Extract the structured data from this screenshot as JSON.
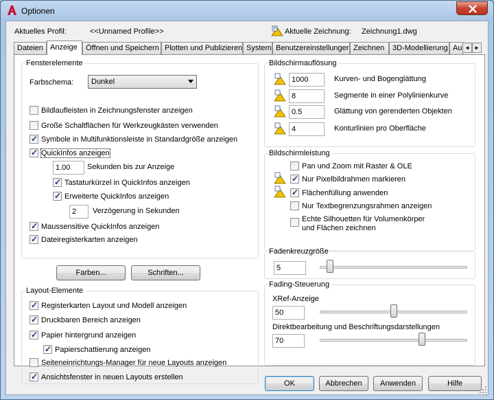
{
  "window": {
    "title": "Optionen",
    "close_label": "✕"
  },
  "header": {
    "profile_label": "Aktuelles Profil:",
    "profile_value": "<<Unnamed Profile>>",
    "drawing_label": "Aktuelle Zeichnung:",
    "drawing_value": "Zeichnung1.dwg"
  },
  "tabs": [
    {
      "label": "Dateien"
    },
    {
      "label": "Anzeige",
      "active": true
    },
    {
      "label": "Öffnen und Speichern"
    },
    {
      "label": "Plotten und Publizieren"
    },
    {
      "label": "System"
    },
    {
      "label": "Benutzereinstellungen"
    },
    {
      "label": "Zeichnen"
    },
    {
      "label": "3D-Modellierung"
    },
    {
      "label": "Au"
    }
  ],
  "tab_scroll": {
    "left": "◄",
    "right": "►"
  },
  "fensterelemente": {
    "legend": "Fensterelemente",
    "farbschema_label": "Farbschema:",
    "farbschema_value": "Dunkel",
    "cb_bildlaufleisten": {
      "label": "Bildlaufleisten in Zeichnungsfenster anzeigen",
      "checked": false
    },
    "cb_schaltflaechen": {
      "label": "Große Schaltflächen für Werkzeugkästen verwenden",
      "checked": false
    },
    "cb_symbole": {
      "label": "Symbole in Multifunktionsleiste in Standardgröße anzeigen",
      "checked": true
    },
    "cb_quickinfos": {
      "label": "QuickInfos anzeigen",
      "checked": true
    },
    "sekunden_value": "1.00",
    "sekunden_label": "Sekunden bis zur Anzeige",
    "cb_tastatur": {
      "label": "Tastaturkürzel in QuickInfos anzeigen",
      "checked": true
    },
    "cb_erweiterte": {
      "label": "Erweiterte QuickInfos anzeigen",
      "checked": true
    },
    "verzoegerung_value": "2",
    "verzoegerung_label": "Verzögerung in Sekunden",
    "cb_maussensitiv": {
      "label": "Maussensitive QuickInfos anzeigen",
      "checked": true
    },
    "cb_dateiregister": {
      "label": "Dateiregisterkarten anzeigen",
      "checked": true
    },
    "farben_button": "Farben...",
    "schriften_button": "Schriften..."
  },
  "layout": {
    "legend": "Layout-Elemente",
    "cb_registerkarten": {
      "label": "Registerkarten Layout und Modell anzeigen",
      "checked": true
    },
    "cb_druckbar": {
      "label": "Druckbaren Bereich anzeigen",
      "checked": true
    },
    "cb_papier": {
      "label": "Papier hintergrund anzeigen",
      "checked": true
    },
    "cb_schattierung": {
      "label": "Papierschattierung anzeigen",
      "checked": true
    },
    "cb_seitenmanager": {
      "label": "Seiteneinrichtungs-Manager für neue Layouts anzeigen",
      "checked": false
    },
    "cb_ansichtsfenster": {
      "label": "Ansichtsfenster in neuen Layouts erstellen",
      "checked": true
    }
  },
  "aufloesung": {
    "legend": "Bildschirmauflösung",
    "rows": [
      {
        "value": "1000",
        "label": "Kurven- und Bogenglättung"
      },
      {
        "value": "8",
        "label": "Segmente in einer Polylinienkurve"
      },
      {
        "value": "0.5",
        "label": "Glättung von gerenderten Objekten"
      },
      {
        "value": "4",
        "label": "Konturlinien pro Oberfläche"
      }
    ]
  },
  "leistung": {
    "legend": "Bildschirmleistung",
    "cb_panzoom": {
      "label": "Pan und Zoom mit Raster & OLE",
      "checked": false
    },
    "cb_pixelbild": {
      "label": "Nur Pixelbildrahmen markieren",
      "checked": true
    },
    "cb_flaechen": {
      "label": "Flächenfüllung anwenden",
      "checked": true
    },
    "cb_textbegrenzung": {
      "label": "Nur Textbegrenzungsrahmen anzeigen",
      "checked": false
    },
    "cb_silhouetten_line1": "Echte Silhouetten für Volumenkörper",
    "cb_silhouetten_line2": "und Flächen zeichnen",
    "cb_silhouetten_checked": false
  },
  "fadenkreuz": {
    "legend": "Fadenkreuzgröße",
    "value": "5",
    "slider_fraction": 0.05
  },
  "fading": {
    "legend": "Fading-Steuerung",
    "xref_label": "XRef-Anzeige",
    "xref_value": "50",
    "xref_fraction": 0.5,
    "direkt_label": "Direktbearbeitung und Beschriftungsdarstellungen",
    "direkt_value": "70",
    "direkt_fraction": 0.7
  },
  "buttons": {
    "ok": "OK",
    "abbrechen": "Abbrechen",
    "anwenden": "Anwenden",
    "hilfe": "Hilfe"
  },
  "colors": {
    "autocad_red": "#c8102e",
    "drawing_icon_yellow": "#f2c200",
    "checkmark": "#1f3a76"
  },
  "icons": {
    "app": "autocad-logo-icon",
    "drawing": "drawing-file-icon",
    "setting": "drawing-setting-icon"
  }
}
